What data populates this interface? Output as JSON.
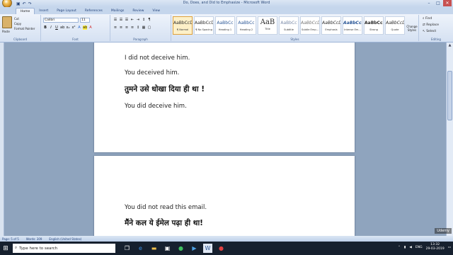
{
  "window": {
    "title": "Do, Does, and Did to Emphasize - Microsoft Word",
    "controls": {
      "minimize": "–",
      "maximize": "□",
      "close": "✕"
    }
  },
  "tabs": [
    "Home",
    "Insert",
    "Page Layout",
    "References",
    "Mailings",
    "Review",
    "View"
  ],
  "ribbon": {
    "clipboard": {
      "paste": "Paste",
      "cut": "Cut",
      "copy": "Copy",
      "format_painter": "Format Painter",
      "label": "Clipboard"
    },
    "font": {
      "name": "Calibri",
      "size": "11",
      "label": "Font"
    },
    "paragraph": {
      "label": "Paragraph"
    },
    "styles": {
      "label": "Styles",
      "items": [
        {
          "sample": "AaBbCcDd",
          "name": "¶ Normal",
          "selected": true
        },
        {
          "sample": "AaBbCcDd",
          "name": "¶ No Spacing",
          "selected": false
        },
        {
          "sample": "AaBbCc",
          "name": "Heading 1",
          "selected": false
        },
        {
          "sample": "AaBbCc",
          "name": "Heading 2",
          "selected": false
        },
        {
          "sample": "AaB",
          "name": "Title",
          "selected": false
        },
        {
          "sample": "AaBbCc",
          "name": "Subtitle",
          "selected": false
        },
        {
          "sample": "AaBbCcDd",
          "name": "Subtle Emp...",
          "selected": false
        },
        {
          "sample": "AaBbCcDd",
          "name": "Emphasis",
          "selected": false
        },
        {
          "sample": "AaBbCcDd",
          "name": "Intense Em...",
          "selected": false
        },
        {
          "sample": "AaBbCcDd",
          "name": "Strong",
          "selected": false
        },
        {
          "sample": "AaBbCcDd",
          "name": "Quote",
          "selected": false
        }
      ],
      "change_styles": "Change Styles"
    },
    "editing": {
      "find": "Find",
      "replace": "Replace",
      "select": "Select",
      "label": "Editing"
    }
  },
  "document": {
    "page1": [
      {
        "text": "I did not deceive him.",
        "lang": "en"
      },
      {
        "text": "You deceived him.",
        "lang": "en"
      },
      {
        "text": "तुमने उसे धोखा दिया ही था !",
        "lang": "hi"
      },
      {
        "text": "You did deceive him.",
        "lang": "en"
      }
    ],
    "page2": [
      {
        "text": "You did not read this email.",
        "lang": "en"
      },
      {
        "text": "मैंने कल ये ईमेल पढ़ा ही था!",
        "lang": "hi"
      }
    ]
  },
  "status": {
    "page": "Page: 5 of 5",
    "words": "Words: 309",
    "language": "English (United States)"
  },
  "taskbar": {
    "search_placeholder": "Type here to search",
    "tray": {
      "lang": "ENG",
      "time": "13:32",
      "date": "29-03-2019"
    }
  },
  "watermark": "Udemy"
}
